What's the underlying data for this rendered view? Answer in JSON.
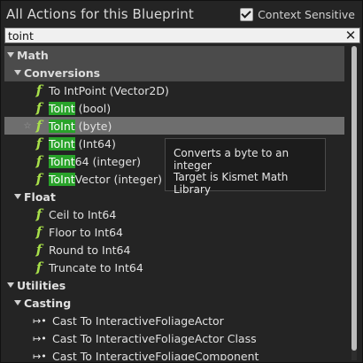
{
  "header": {
    "title": "All Actions for this Blueprint",
    "context_sensitive_label": "Context Sensitive",
    "context_sensitive_checked": true
  },
  "search": {
    "value": "toint",
    "clear_icon": "close-icon"
  },
  "tree": {
    "math": "Math",
    "conversions": "Conversions",
    "conv_items": [
      {
        "pre": "To IntPoint (Vector2D)",
        "hl": "",
        "post": ""
      },
      {
        "pre": "",
        "hl": "ToInt",
        "post": " (bool)"
      },
      {
        "pre": "",
        "hl": "ToInt",
        "post": " (byte)"
      },
      {
        "pre": "",
        "hl": "ToInt",
        "post": " (Int64)"
      },
      {
        "pre": "",
        "hl": "ToInt",
        "post": "64 (integer)"
      },
      {
        "pre": "",
        "hl": "ToInt",
        "post": "Vector (integer)"
      }
    ],
    "float": "Float",
    "float_items": [
      "Ceil to Int64",
      "Floor to Int64",
      "Round to Int64",
      "Truncate to Int64"
    ],
    "utilities": "Utilities",
    "casting": "Casting",
    "cast_items": [
      "Cast To InteractiveFoliageActor",
      "Cast To InteractiveFoliageActor Class",
      "Cast To InteractiveFoliageComponent"
    ]
  },
  "tooltip": {
    "line1": "Converts a byte to an integer",
    "line2": "Target is Kismet Math Library"
  },
  "colors": {
    "highlight": "#29a32a",
    "function_icon": "#a8e04a"
  }
}
